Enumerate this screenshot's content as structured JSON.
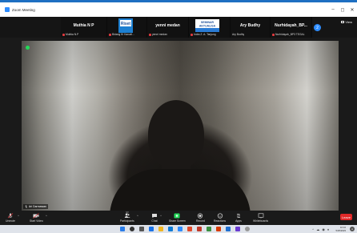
{
  "window": {
    "title": "Zoom Meeting",
    "minimize": "–",
    "restore": "◻",
    "close": "✕"
  },
  "view": {
    "label": "View"
  },
  "gallery": [
    {
      "name": "Muthia N P",
      "sub": "Muthia N.P"
    },
    {
      "name": "",
      "sub": "Bidang KI Kanwil..."
    },
    {
      "name": "yenni medan",
      "sub": "yenni medan"
    },
    {
      "name": "",
      "sub": "Indra Z. A. Tanjung"
    },
    {
      "name": "Ary Budhy",
      "sub": "Ary Budhy"
    },
    {
      "name": "Nurhidayah_BP...",
      "sub": "Nurhidayah_BP3 TEGAL"
    }
  ],
  "gallery_images": {
    "riset": "Riset",
    "seminar_top": "SEMINAR",
    "seminar_mid": "AKTUALISA"
  },
  "more_badge": "2",
  "speaker": {
    "name": "Ari Darmawan"
  },
  "toolbar": {
    "unmute": "Unmute",
    "start_video": "Start Video",
    "participants": "Participants",
    "participant_count": "37",
    "chat": "Chat",
    "share_screen": "Share Screen",
    "record": "Record",
    "reactions": "Reactions",
    "apps": "Apps",
    "whiteboards": "Whiteboards",
    "leave": "Leave"
  },
  "tray": {
    "time": "10:10",
    "date": "5/25/2023"
  },
  "colors": {
    "accent": "#2d8cff",
    "share_green": "#23d959",
    "leave_red": "#e02828",
    "muted_red": "#e0393e"
  }
}
